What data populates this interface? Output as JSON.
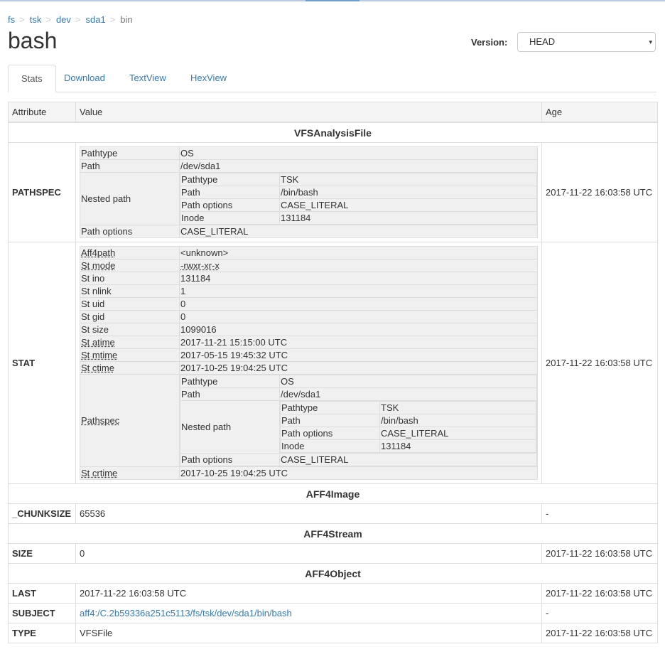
{
  "breadcrumb": [
    "fs",
    "tsk",
    "dev",
    "sda1"
  ],
  "breadcrumb_current": "bin",
  "breadcrumb_sep": ">",
  "page_title": "bash",
  "version": {
    "label": "Version:",
    "value": "HEAD",
    "arrow": "▾"
  },
  "tabs": [
    "Stats",
    "Download",
    "TextView",
    "HexView"
  ],
  "table": {
    "headers": {
      "attribute": "Attribute",
      "value": "Value",
      "age": "Age"
    },
    "sections": {
      "vfs": "VFSAnalysisFile",
      "image": "AFF4Image",
      "stream": "AFF4Stream",
      "object": "AFF4Object"
    },
    "pathspec": {
      "attr": "PATHSPEC",
      "age": "2017-11-22 16:03:58 UTC",
      "rows": {
        "pathtype_k": "Pathtype",
        "pathtype_v": "OS",
        "path_k": "Path",
        "path_v": "/dev/sda1",
        "nested_k": "Nested path",
        "nested": {
          "pathtype_k": "Pathtype",
          "pathtype_v": "TSK",
          "path_k": "Path",
          "path_v": "/bin/bash",
          "options_k": "Path options",
          "options_v": "CASE_LITERAL",
          "inode_k": "Inode",
          "inode_v": "131184"
        },
        "options_k": "Path options",
        "options_v": "CASE_LITERAL"
      }
    },
    "stat": {
      "attr": "STAT",
      "age": "2017-11-22 16:03:58 UTC",
      "aff4path_k": "Aff4path",
      "aff4path_v": "<unknown>",
      "st_mode_k": "St mode",
      "st_mode_v": "-rwxr-xr-x",
      "st_ino_k": "St ino",
      "st_ino_v": "131184",
      "st_nlink_k": "St nlink",
      "st_nlink_v": "1",
      "st_uid_k": "St uid",
      "st_uid_v": "0",
      "st_gid_k": "St gid",
      "st_gid_v": "0",
      "st_size_k": "St size",
      "st_size_v": "1099016",
      "st_atime_k": "St atime",
      "st_atime_v": "2017-11-21 15:15:00 UTC",
      "st_mtime_k": "St mtime",
      "st_mtime_v": "2017-05-15 19:45:32 UTC",
      "st_ctime_k": "St ctime",
      "st_ctime_v": "2017-10-25 19:04:25 UTC",
      "pathspec_k": "Pathspec",
      "pathspec": {
        "pathtype_k": "Pathtype",
        "pathtype_v": "OS",
        "path_k": "Path",
        "path_v": "/dev/sda1",
        "nested_k": "Nested path",
        "nested": {
          "pathtype_k": "Pathtype",
          "pathtype_v": "TSK",
          "path_k": "Path",
          "path_v": "/bin/bash",
          "options_k": "Path options",
          "options_v": "CASE_LITERAL",
          "inode_k": "Inode",
          "inode_v": "131184"
        },
        "options_k": "Path options",
        "options_v": "CASE_LITERAL"
      },
      "st_crtime_k": "St crtime",
      "st_crtime_v": "2017-10-25 19:04:25 UTC"
    },
    "chunksize": {
      "attr": "_CHUNKSIZE",
      "value": "65536",
      "age": "-"
    },
    "size": {
      "attr": "SIZE",
      "value": "0",
      "age": "2017-11-22 16:03:58 UTC"
    },
    "last": {
      "attr": "LAST",
      "value": "2017-11-22 16:03:58 UTC",
      "age": "2017-11-22 16:03:58 UTC"
    },
    "subject": {
      "attr": "SUBJECT",
      "value": "aff4:/C.2b59336a251c5113/fs/tsk/dev/sda1/bin/bash",
      "age": "-"
    },
    "type": {
      "attr": "TYPE",
      "value": "VFSFile",
      "age": "2017-11-22 16:03:58 UTC"
    }
  }
}
